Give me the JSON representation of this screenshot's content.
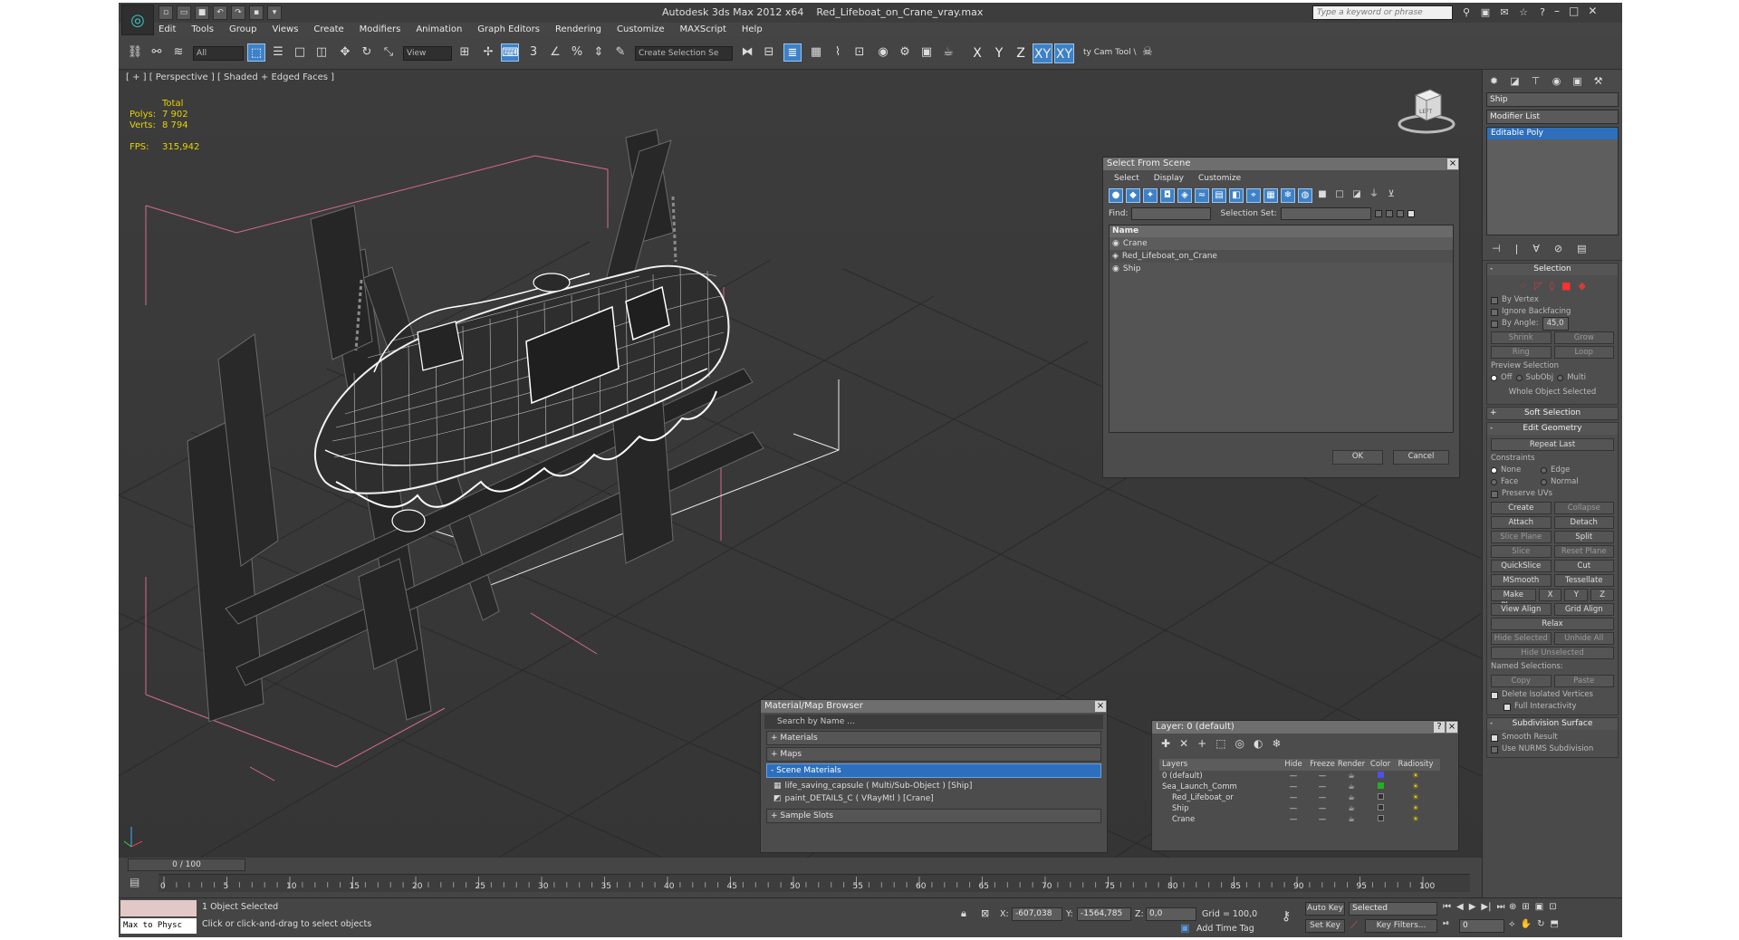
{
  "window": {
    "app_name": "Autodesk 3ds Max  2012 x64",
    "file_name": "Red_Lifeboat_on_Crane_vray.max",
    "search_placeholder": "Type a keyword or phrase"
  },
  "menu": [
    "Edit",
    "Tools",
    "Group",
    "Views",
    "Create",
    "Modifiers",
    "Animation",
    "Graph Editors",
    "Rendering",
    "Customize",
    "MAXScript",
    "Help"
  ],
  "toolbar": {
    "selection_filter": "All",
    "reference_coord": "View",
    "named_selection_placeholder": "Create Selection Se",
    "axis_labels": [
      "X",
      "Y",
      "Z",
      "XY",
      "XY"
    ],
    "cam_tool": "ty Cam Tool \\"
  },
  "viewport": {
    "label": "[ + ] [ Perspective ] [ Shaded + Edged Faces ]",
    "stats": {
      "total_label": "Total",
      "polys_label": "Polys:",
      "polys_value": "7 902",
      "verts_label": "Verts:",
      "verts_value": "8 794",
      "fps_label": "FPS:",
      "fps_value": "315,942"
    },
    "viewcube_label": "LEFT"
  },
  "select_from_scene": {
    "title": "Select From Scene",
    "menu": [
      "Select",
      "Display",
      "Customize"
    ],
    "find_label": "Find:",
    "selection_set_label": "Selection Set:",
    "column_name": "Name",
    "items": [
      "Crane",
      "Red_Lifeboat_on_Crane",
      "Ship"
    ],
    "ok_label": "OK",
    "cancel_label": "Cancel"
  },
  "material_browser": {
    "title": "Material/Map Browser",
    "search_placeholder": "Search by Name ...",
    "groups": [
      "+ Materials",
      "+ Maps",
      "- Scene Materials"
    ],
    "materials": [
      "life_saving_capsule  ( Multi/Sub-Object ) [Ship]",
      "paint_DETAILS_C  ( VRayMtl ) [Crane]"
    ],
    "sample_slots": "+ Sample Slots"
  },
  "layer_manager": {
    "title": "Layer: 0 (default)",
    "columns": [
      "Layers",
      "Hide",
      "Freeze",
      "Render",
      "Color",
      "Radiosity"
    ],
    "rows": [
      {
        "name": "0 (default)",
        "color": "#5050e0"
      },
      {
        "name": "Sea_Launch_Comm",
        "color": "#20b020"
      },
      {
        "name": "Red_Lifeboat_or",
        "color": "#303030"
      },
      {
        "name": "Ship",
        "color": "#303030"
      },
      {
        "name": "Crane",
        "color": "#303030"
      }
    ]
  },
  "command_panel": {
    "object_name": "Ship",
    "modifier_list": "Modifier List",
    "modifier_item": "Editable Poly",
    "selection": {
      "title": "Selection",
      "by_vertex": "By Vertex",
      "ignore_backfacing": "Ignore Backfacing",
      "by_angle": "By Angle:",
      "angle_value": "45,0",
      "shrink": "Shrink",
      "grow": "Grow",
      "ring": "Ring",
      "loop": "Loop",
      "preview_selection": "Preview Selection",
      "preview_opts": [
        "Off",
        "SubObj",
        "Multi"
      ],
      "whole_object": "Whole Object Selected"
    },
    "soft_selection": "Soft Selection",
    "edit_geometry": {
      "title": "Edit Geometry",
      "repeat_last": "Repeat Last",
      "constraints": "Constraints",
      "constraint_opts": [
        "None",
        "Edge",
        "Face",
        "Normal"
      ],
      "preserve_uvs": "Preserve UVs",
      "create": "Create",
      "collapse": "Collapse",
      "attach": "Attach",
      "detach": "Detach",
      "slice_plane": "Slice Plane",
      "split": "Split",
      "slice": "Slice",
      "reset_plane": "Reset Plane",
      "quickslice": "QuickSlice",
      "cut": "Cut",
      "msmooth": "MSmooth",
      "tessellate": "Tessellate",
      "make_planar": "Make Planar",
      "xyz": [
        "X",
        "Y",
        "Z"
      ],
      "view_align": "View Align",
      "grid_align": "Grid Align",
      "relax": "Relax",
      "hide_selected": "Hide Selected",
      "unhide_all": "Unhide All",
      "hide_unselected": "Hide Unselected",
      "named_selections": "Named Selections:",
      "copy": "Copy",
      "paste": "Paste",
      "delete_isolated": "Delete Isolated Vertices",
      "full_interactivity": "Full Interactivity"
    },
    "subdivision": {
      "title": "Subdivision Surface",
      "smooth_result": "Smooth Result",
      "nurms": "Use NURMS Subdivision"
    }
  },
  "timeline": {
    "slider": "0 / 100",
    "ticks": [
      "0",
      "5",
      "10",
      "15",
      "20",
      "25",
      "30",
      "35",
      "40",
      "45",
      "50",
      "55",
      "60",
      "65",
      "70",
      "75",
      "80",
      "85",
      "90",
      "95",
      "100"
    ]
  },
  "status": {
    "maxscript": "Max to Physc",
    "selected": "1 Object Selected",
    "prompt": "Click or click-and-drag to select objects",
    "x_label": "X:",
    "x_value": "-607,038",
    "y_label": "Y:",
    "y_value": "-1564,785",
    "z_label": "Z:",
    "z_value": "0,0",
    "grid": "Grid = 100,0",
    "add_time_tag": "Add Time Tag",
    "auto_key": "Auto Key",
    "set_key": "Set Key",
    "key_mode": "Selected",
    "key_filters": "Key Filters...",
    "frame": "0"
  }
}
